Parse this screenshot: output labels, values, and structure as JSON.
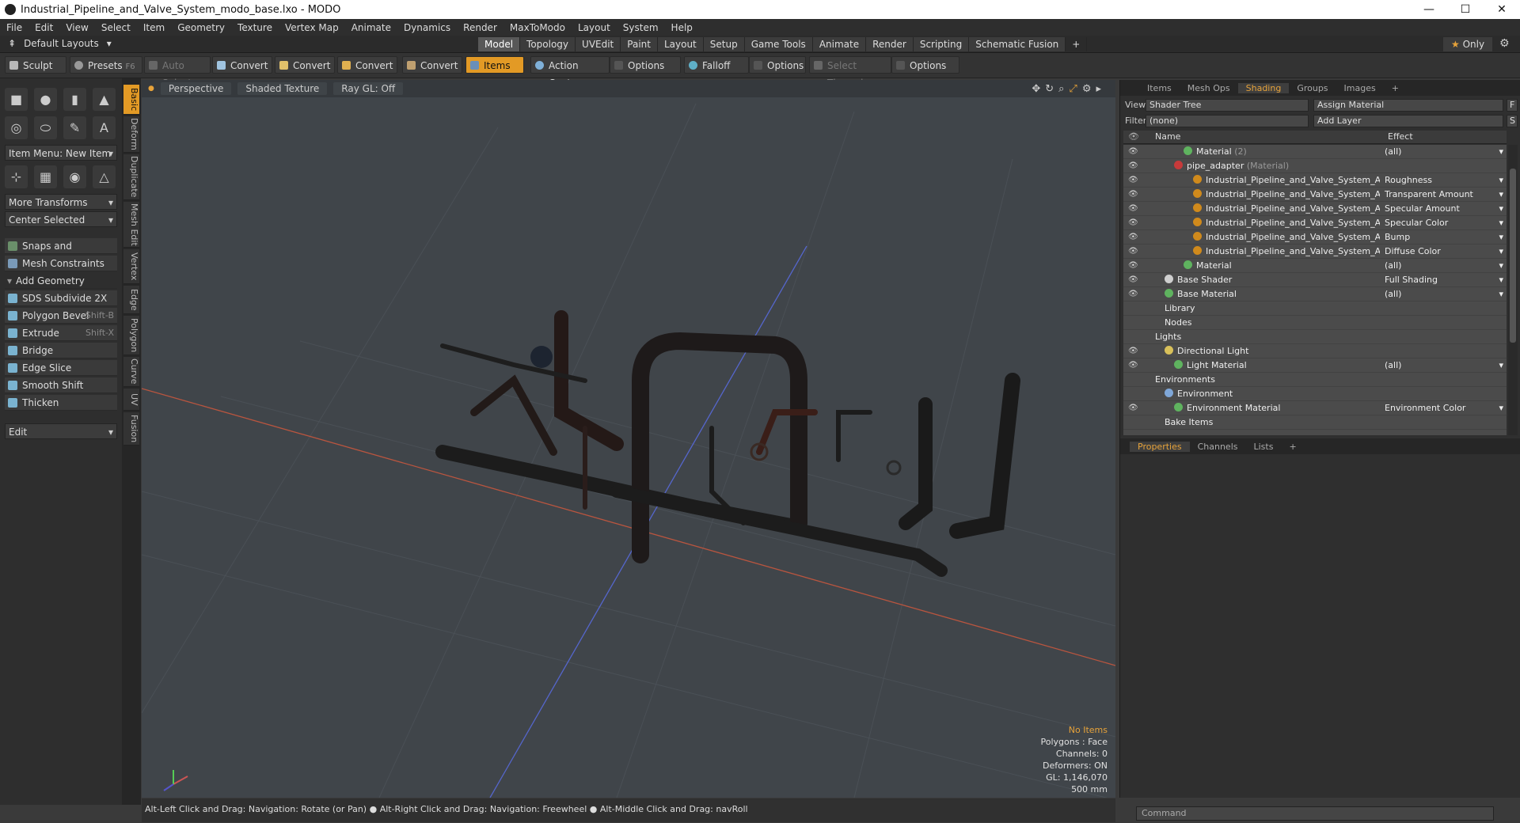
{
  "window": {
    "title": "Industrial_Pipeline_and_Valve_System_modo_base.lxo - MODO",
    "minimize": "—",
    "maximize": "☐",
    "close": "✕"
  },
  "menu": [
    "File",
    "Edit",
    "View",
    "Select",
    "Item",
    "Geometry",
    "Texture",
    "Vertex Map",
    "Animate",
    "Dynamics",
    "Render",
    "MaxToModo",
    "Layout",
    "System",
    "Help"
  ],
  "layouts_label": "Default Layouts",
  "mode_tabs": [
    "Model",
    "Topology",
    "UVEdit",
    "Paint",
    "Layout",
    "Setup",
    "Game Tools",
    "Animate",
    "Render",
    "Scripting",
    "Schematic Fusion"
  ],
  "mode_add": "+",
  "only_label": "Only",
  "toolbar": {
    "sculpt": "Sculpt",
    "presets": "Presets",
    "presets_key": "F6",
    "auto_select": "Auto Select",
    "convert1": "Convert",
    "convert2": "Convert",
    "convert3": "Convert",
    "convert4": "Convert",
    "items": "Items",
    "action_center": "Action Center",
    "options1": "Options",
    "falloff": "Falloff",
    "options2": "Options",
    "select_through": "Select Through",
    "options3": "Options"
  },
  "left": {
    "vtabs": [
      "Basic",
      "Deform",
      "Duplicate",
      "Mesh Edit",
      "Vertex",
      "Edge",
      "Polygon",
      "Curve",
      "UV",
      "Fusion"
    ],
    "item_menu": "Item Menu: New Item",
    "more_transforms": "More Transforms",
    "center_selected": "Center Selected",
    "snaps": "Snaps and Precision",
    "mesh_constraints": "Mesh Constraints",
    "add_geometry": "Add Geometry",
    "tools": [
      {
        "label": "SDS Subdivide 2X",
        "key": ""
      },
      {
        "label": "Polygon Bevel",
        "key": "Shift-B"
      },
      {
        "label": "Extrude",
        "key": "Shift-X"
      },
      {
        "label": "Bridge",
        "key": ""
      },
      {
        "label": "Edge Slice",
        "key": ""
      },
      {
        "label": "Smooth Shift",
        "key": ""
      },
      {
        "label": "Thicken",
        "key": ""
      }
    ],
    "edit": "Edit"
  },
  "viewport": {
    "perspective": "Perspective",
    "shading": "Shaded Texture",
    "raygl": "Ray GL: Off",
    "info": {
      "no_items": "No Items",
      "polygons": "Polygons : Face",
      "channels": "Channels: 0",
      "deformers": "Deformers: ON",
      "gl": "GL: 1,146,070",
      "scale": "500 mm"
    }
  },
  "status": "Alt-Left Click and Drag: Navigation: Rotate (or Pan) ● Alt-Right Click and Drag: Navigation: Freewheel ● Alt-Middle Click and Drag: navRoll",
  "right": {
    "tabs": [
      "Items",
      "Mesh Ops",
      "Shading",
      "Groups",
      "Images",
      "+"
    ],
    "view_label": "View",
    "view_value": "Shader Tree",
    "assign": "Assign Material",
    "f_btn": "F",
    "filter_label": "Filter",
    "filter_value": "(none)",
    "add_layer": "Add Layer",
    "s_btn": "S",
    "col_name": "Name",
    "col_effect": "Effect",
    "tree": [
      {
        "name": "Material",
        "sub": "(2)",
        "effect": "(all)",
        "indent": 3,
        "color": "#5fb35f",
        "eye": true
      },
      {
        "name": "pipe_adapter",
        "sub": "(Material)",
        "effect": "",
        "indent": 2,
        "color": "#c73a3a",
        "eye": true
      },
      {
        "name": "Industrial_Pipeline_and_Valve_System_Ada ...",
        "sub": "",
        "effect": "Roughness",
        "indent": 4,
        "color": "#d08a1c",
        "eye": true
      },
      {
        "name": "Industrial_Pipeline_and_Valve_System_Ada ...",
        "sub": "",
        "effect": "Transparent Amount",
        "indent": 4,
        "color": "#d08a1c",
        "eye": true
      },
      {
        "name": "Industrial_Pipeline_and_Valve_System_Ada ...",
        "sub": "",
        "effect": "Specular Amount",
        "indent": 4,
        "color": "#d08a1c",
        "eye": true
      },
      {
        "name": "Industrial_Pipeline_and_Valve_System_Ada ...",
        "sub": "",
        "effect": "Specular Color",
        "indent": 4,
        "color": "#d08a1c",
        "eye": true
      },
      {
        "name": "Industrial_Pipeline_and_Valve_System_Ada ...",
        "sub": "",
        "effect": "Bump",
        "indent": 4,
        "color": "#d08a1c",
        "eye": true
      },
      {
        "name": "Industrial_Pipeline_and_Valve_System_Ada ...",
        "sub": "",
        "effect": "Diffuse Color",
        "indent": 4,
        "color": "#d08a1c",
        "eye": true
      },
      {
        "name": "Material",
        "sub": "",
        "effect": "(all)",
        "indent": 3,
        "color": "#5fb35f",
        "eye": true
      },
      {
        "name": "Base Shader",
        "sub": "",
        "effect": "Full Shading",
        "indent": 1,
        "color": "#cfcfcf",
        "eye": true
      },
      {
        "name": "Base Material",
        "sub": "",
        "effect": "(all)",
        "indent": 1,
        "color": "#5fb35f",
        "eye": true
      },
      {
        "name": "Library",
        "sub": "",
        "effect": "",
        "indent": 1,
        "color": "",
        "eye": false
      },
      {
        "name": "Nodes",
        "sub": "",
        "effect": "",
        "indent": 1,
        "color": "",
        "eye": false
      },
      {
        "name": "Lights",
        "sub": "",
        "effect": "",
        "indent": 0,
        "color": "",
        "eye": false
      },
      {
        "name": "Directional Light",
        "sub": "",
        "effect": "",
        "indent": 1,
        "color": "#d8c05a",
        "eye": true
      },
      {
        "name": "Light Material",
        "sub": "",
        "effect": "(all)",
        "indent": 2,
        "color": "#5fb35f",
        "eye": true
      },
      {
        "name": "Environments",
        "sub": "",
        "effect": "",
        "indent": 0,
        "color": "",
        "eye": false
      },
      {
        "name": "Environment",
        "sub": "",
        "effect": "",
        "indent": 1,
        "color": "#7fa7d8",
        "eye": false
      },
      {
        "name": "Environment Material",
        "sub": "",
        "effect": "Environment Color",
        "indent": 2,
        "color": "#5fb35f",
        "eye": true
      },
      {
        "name": "Bake Items",
        "sub": "",
        "effect": "",
        "indent": 1,
        "color": "",
        "eye": false
      }
    ],
    "ptabs": [
      "Properties",
      "Channels",
      "Lists",
      "+"
    ],
    "command_placeholder": "Command"
  }
}
